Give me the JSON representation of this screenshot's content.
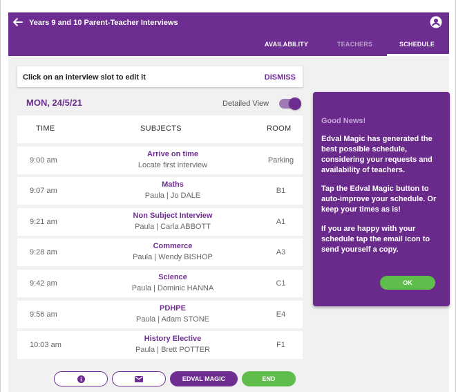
{
  "header": {
    "title": "Years 9 and 10 Parent-Teacher Interviews",
    "tabs": [
      {
        "label": "AVAILABILITY"
      },
      {
        "label": "TEACHERS"
      },
      {
        "label": "SCHEDULE"
      }
    ],
    "active_tab": "SCHEDULE",
    "icons": {
      "back": "arrow-left-icon",
      "account": "account-icon"
    }
  },
  "hint": {
    "text": "Click on an interview slot to edit it",
    "dismiss_label": "DISMISS"
  },
  "schedule": {
    "date": "MON, 24/5/21",
    "detailed_view_label": "Detailed View",
    "detailed_view_on": true,
    "columns": [
      "TIME",
      "SUBJECTS",
      "ROOM"
    ],
    "rows": [
      {
        "time": "9:00 am",
        "subject": "Arrive on time",
        "detail": "Locate first interview",
        "room": "Parking"
      },
      {
        "time": "9:07 am",
        "subject": "Maths",
        "detail": "Paula | Jo DALE",
        "room": "B1"
      },
      {
        "time": "9:21 am",
        "subject": "Non Subject Interview",
        "detail": "Paula | Carla ABBOTT",
        "room": "A1"
      },
      {
        "time": "9:28 am",
        "subject": "Commerce",
        "detail": "Paula | Wendy BISHOP",
        "room": "A3"
      },
      {
        "time": "9:42 am",
        "subject": "Science",
        "detail": "Paula | Dominic HANNA",
        "room": "C1"
      },
      {
        "time": "9:56 am",
        "subject": "PDHPE",
        "detail": "Paula | Adam STONE",
        "room": "E4"
      },
      {
        "time": "10:03 am",
        "subject": "History Elective",
        "detail": "Paula | Brett POTTER",
        "room": "F1"
      }
    ]
  },
  "panel": {
    "title": "Good News!",
    "paragraphs": [
      "Edval Magic has generated the best possible schedule, considering your requests and availability of teachers.",
      "Tap the Edval Magic button to auto-improve your schedule. Or keep your times as is!",
      "If you are happy with your schedule tap the email icon to send yourself a copy."
    ],
    "ok_label": "OK"
  },
  "footer": {
    "info_icon": "info-icon",
    "email_icon": "email-icon",
    "magic_label": "EDVAL MAGIC",
    "end_label": "END"
  },
  "colors": {
    "brand_purple": "#6e2d91",
    "accent_green": "#5fbd4b",
    "panel_purple": "#6a2a8c"
  }
}
